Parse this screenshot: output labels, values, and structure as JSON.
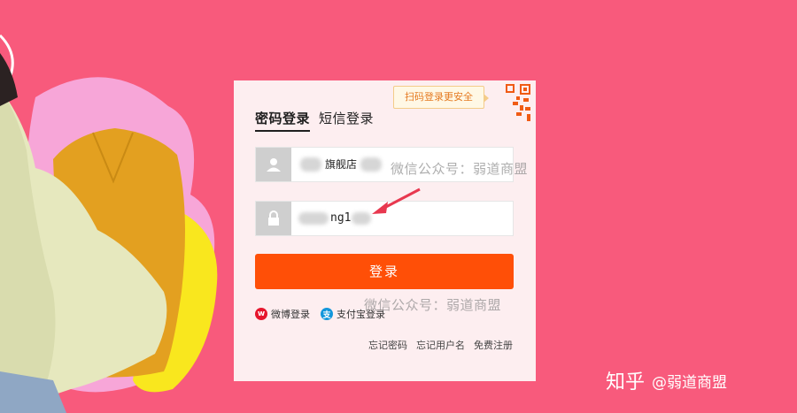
{
  "colors": {
    "background": "#f85a7c",
    "card": "#fdeef0",
    "login_button": "#ff4f07",
    "qr_tip_text": "#e57a21"
  },
  "qr_tip": {
    "text": "扫码登录更安全"
  },
  "tabs": [
    {
      "label": "密码登录",
      "active": true
    },
    {
      "label": "短信登录",
      "active": false
    }
  ],
  "username_field": {
    "icon": "user-icon",
    "value": "旗舰店"
  },
  "password_field": {
    "icon": "lock-icon",
    "value": "ng1"
  },
  "login_button": {
    "label": "登录"
  },
  "alt_login": [
    {
      "icon": "weibo-icon",
      "label": "微博登录"
    },
    {
      "icon": "alipay-icon",
      "label": "支付宝登录"
    }
  ],
  "links": [
    {
      "label": "忘记密码"
    },
    {
      "label": "忘记用户名"
    },
    {
      "label": "免费注册"
    }
  ],
  "watermarks": [
    "微信公众号：弱道商盟",
    "微信公众号：弱道商盟"
  ],
  "source_mark": {
    "site": "知乎",
    "account": "@弱道商盟"
  }
}
